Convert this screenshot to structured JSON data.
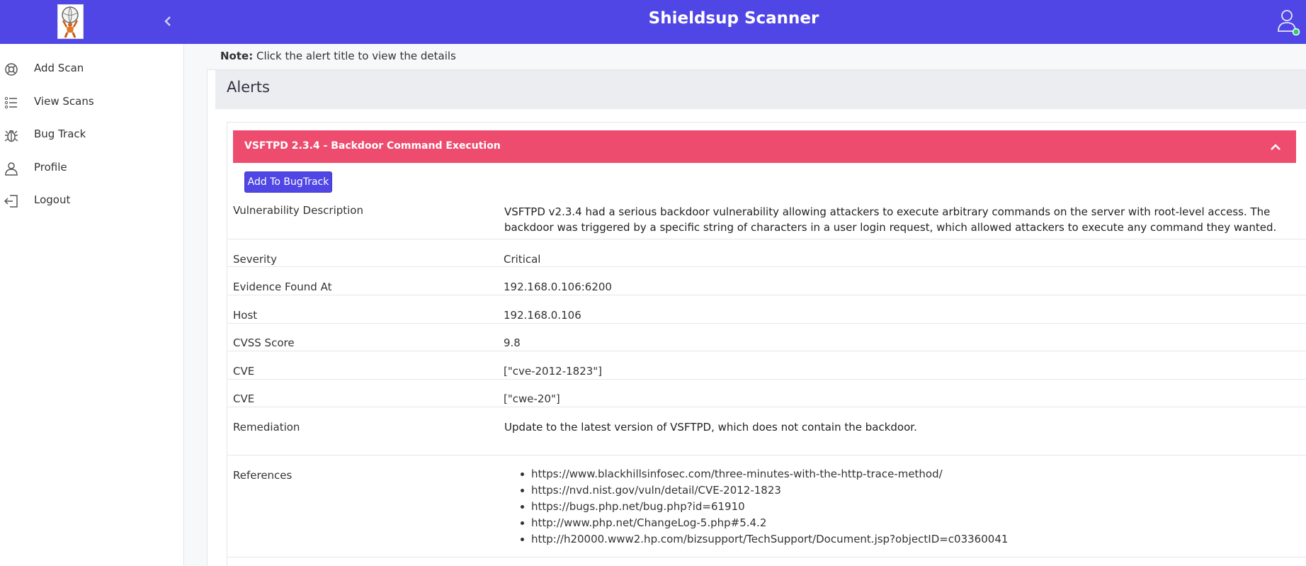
{
  "header": {
    "title": "Shieldsup Scanner",
    "logo_icon": "atlas-logo-icon",
    "collapse_icon": "chevron-left-icon",
    "user_icon": "user-icon",
    "brand_color": "#5046e5"
  },
  "sidebar": {
    "items": [
      {
        "label": "Add Scan",
        "icon": "lifebuoy-icon"
      },
      {
        "label": "View Scans",
        "icon": "list-icon"
      },
      {
        "label": "Bug Track",
        "icon": "bug-icon"
      },
      {
        "label": "Profile",
        "icon": "user-icon"
      },
      {
        "label": "Logout",
        "icon": "logout-icon"
      }
    ]
  },
  "note": {
    "prefix": "Note:",
    "text": " Click the alert title to view the details"
  },
  "alerts": {
    "heading": "Alerts",
    "alert": {
      "title": "VSFTPD 2.3.4 - Backdoor Command Execution",
      "bar_color": "#ee4c6e",
      "toggle_icon": "chevron-up-icon",
      "add_button": "Add To BugTrack",
      "fields": {
        "description": {
          "label": "Vulnerability Description",
          "value": "VSFTPD v2.3.4 had a serious backdoor vulnerability allowing attackers to execute arbitrary commands on the server with root-level access. The backdoor was triggered by a specific string of characters in a user login request, which allowed attackers to execute any command they wanted."
        },
        "severity": {
          "label": "Severity",
          "value": "Critical"
        },
        "evidence": {
          "label": "Evidence Found At",
          "value": "192.168.0.106:6200"
        },
        "host": {
          "label": "Host",
          "value": "192.168.0.106"
        },
        "cvss": {
          "label": "CVSS Score",
          "value": "9.8"
        },
        "cve": {
          "label": "CVE",
          "value": "[\"cve-2012-1823\"]"
        },
        "cwe": {
          "label": "CVE",
          "value": "[\"cwe-20\"]"
        },
        "remediation": {
          "label": "Remediation",
          "value": "Update to the latest version of VSFTPD, which does not contain the backdoor."
        },
        "references": {
          "label": "References"
        }
      },
      "references": [
        "https://www.blackhillsinfosec.com/three-minutes-with-the-http-trace-method/",
        "https://nvd.nist.gov/vuln/detail/CVE-2012-1823",
        "https://bugs.php.net/bug.php?id=61910",
        "http://www.php.net/ChangeLog-5.php#5.4.2",
        "http://h20000.www2.hp.com/bizsupport/TechSupport/Document.jsp?objectID=c03360041"
      ]
    }
  }
}
